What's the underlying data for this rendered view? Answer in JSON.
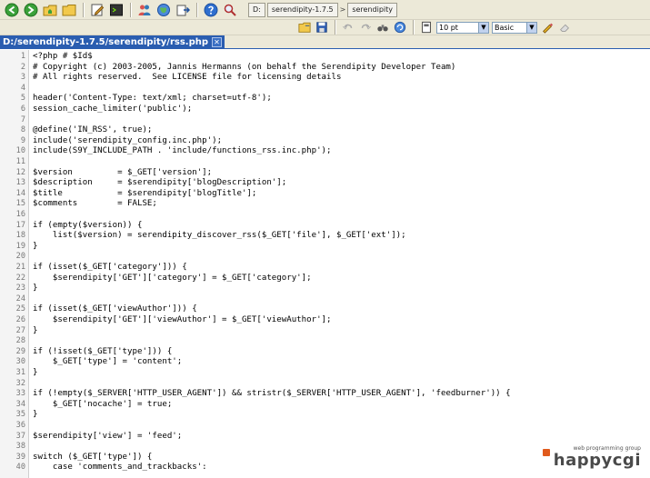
{
  "toolbar": {
    "buttons": [
      {
        "name": "back-button",
        "icon": "arrow-left-icon"
      },
      {
        "name": "forward-button",
        "icon": "arrow-right-icon"
      },
      {
        "name": "home-folder-button",
        "icon": "folder-home-icon"
      },
      {
        "name": "open-folder-button",
        "icon": "folder-icon"
      },
      {
        "name": "edit-button",
        "icon": "edit-icon"
      },
      {
        "name": "terminal-button",
        "icon": "terminal-icon"
      },
      {
        "name": "users-button",
        "icon": "users-icon"
      },
      {
        "name": "globe-button",
        "icon": "globe-icon"
      },
      {
        "name": "export-button",
        "icon": "export-icon"
      },
      {
        "name": "help-button",
        "icon": "help-icon"
      },
      {
        "name": "search-button",
        "icon": "search-icon"
      }
    ],
    "path": [
      "D:",
      "serendipity-1.7.5",
      "serendipity"
    ],
    "path_arrow": ">"
  },
  "format_toolbar": {
    "font_size": "10 pt",
    "style": "Basic",
    "dropdown_arrow": "▼"
  },
  "tab": {
    "label": "D:/serendipity-1.7.5/serendipity/rss.php",
    "close_glyph": "✕"
  },
  "code": {
    "lines": [
      {
        "n": "1",
        "text": "<?php # $Id$"
      },
      {
        "n": "2",
        "text": "# Copyright (c) 2003-2005, Jannis Hermanns (on behalf the Serendipity Developer Team)"
      },
      {
        "n": "3",
        "text": "# All rights reserved.  See LICENSE file for licensing details"
      },
      {
        "n": "4",
        "text": ""
      },
      {
        "n": "5",
        "text": "header('Content-Type: text/xml; charset=utf-8');"
      },
      {
        "n": "6",
        "text": "session_cache_limiter('public');"
      },
      {
        "n": "7",
        "text": ""
      },
      {
        "n": "8",
        "text": "@define('IN_RSS', true);"
      },
      {
        "n": "9",
        "text": "include('serendipity_config.inc.php');"
      },
      {
        "n": "10",
        "text": "include(S9Y_INCLUDE_PATH . 'include/functions_rss.inc.php');"
      },
      {
        "n": "11",
        "text": ""
      },
      {
        "n": "12",
        "text": "$version         = $_GET['version'];"
      },
      {
        "n": "13",
        "text": "$description     = $serendipity['blogDescription'];"
      },
      {
        "n": "14",
        "text": "$title           = $serendipity['blogTitle'];"
      },
      {
        "n": "15",
        "text": "$comments        = FALSE;"
      },
      {
        "n": "16",
        "text": ""
      },
      {
        "n": "17",
        "text": "if (empty($version)) {"
      },
      {
        "n": "18",
        "text": "    list($version) = serendipity_discover_rss($_GET['file'], $_GET['ext']);"
      },
      {
        "n": "19",
        "text": "}"
      },
      {
        "n": "20",
        "text": ""
      },
      {
        "n": "21",
        "text": "if (isset($_GET['category'])) {"
      },
      {
        "n": "22",
        "text": "    $serendipity['GET']['category'] = $_GET['category'];"
      },
      {
        "n": "23",
        "text": "}"
      },
      {
        "n": "24",
        "text": ""
      },
      {
        "n": "25",
        "text": "if (isset($_GET['viewAuthor'])) {"
      },
      {
        "n": "26",
        "text": "    $serendipity['GET']['viewAuthor'] = $_GET['viewAuthor'];"
      },
      {
        "n": "27",
        "text": "}"
      },
      {
        "n": "28",
        "text": ""
      },
      {
        "n": "29",
        "text": "if (!isset($_GET['type'])) {"
      },
      {
        "n": "30",
        "text": "    $_GET['type'] = 'content';"
      },
      {
        "n": "31",
        "text": "}"
      },
      {
        "n": "32",
        "text": ""
      },
      {
        "n": "33",
        "text": "if (!empty($_SERVER['HTTP_USER_AGENT']) && stristr($_SERVER['HTTP_USER_AGENT'], 'feedburner')) {"
      },
      {
        "n": "34",
        "text": "    $_GET['nocache'] = true;"
      },
      {
        "n": "35",
        "text": "}"
      },
      {
        "n": "36",
        "text": ""
      },
      {
        "n": "37",
        "text": "$serendipity['view'] = 'feed';"
      },
      {
        "n": "38",
        "text": ""
      },
      {
        "n": "39",
        "text": "switch ($_GET['type']) {"
      },
      {
        "n": "40",
        "text": "    case 'comments_and_trackbacks':"
      }
    ]
  },
  "brand": {
    "tagline": "web programming group",
    "name": "happycgi"
  }
}
